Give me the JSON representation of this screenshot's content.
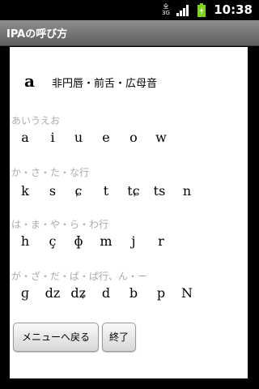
{
  "status_bar": {
    "time": "10:38",
    "network_label": "3G",
    "network_label_top": "全",
    "icons": [
      "signal-icon",
      "battery-icon"
    ]
  },
  "title": "IPAの呼び方",
  "main": {
    "symbol": "a",
    "description": "非円唇・前舌・広母音"
  },
  "groups": [
    {
      "label": "あいうえお",
      "symbols": [
        "a",
        "i",
        "u",
        "e",
        "o",
        "w"
      ]
    },
    {
      "label": "か・さ・た・な行",
      "symbols": [
        "k",
        "s",
        "ɕ",
        "t",
        "tɕ",
        "ts",
        "n"
      ]
    },
    {
      "label": "は・ま・や・ら・わ行",
      "symbols": [
        "h",
        "ç",
        "ɸ",
        "m",
        "j",
        "r"
      ]
    },
    {
      "label": "が・ざ・だ・ば・ぱ行、ん・ー",
      "symbols": [
        "ɡ",
        "dz",
        "dʑ",
        "d",
        "b",
        "p",
        "N"
      ]
    }
  ],
  "buttons": {
    "menu": "メニューへ戻る",
    "end": "終了"
  },
  "colors": {
    "title_bar": "#6e6e6e",
    "background": "#000000",
    "content": "#ffffff",
    "group_label": "#aaaaaa",
    "battery": "#7ed321"
  }
}
